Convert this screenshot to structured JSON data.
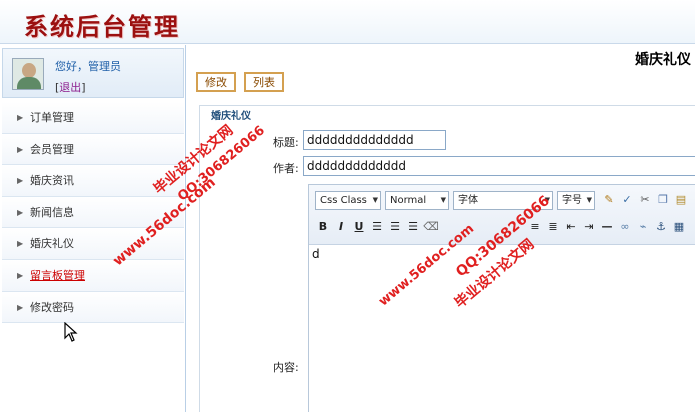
{
  "header": {
    "title": "系统后台管理"
  },
  "user": {
    "greeting": "您好，管理员",
    "logout_open": "[",
    "logout_label": "退出",
    "logout_close": "]"
  },
  "menu": {
    "items": [
      {
        "label": "订单管理"
      },
      {
        "label": "会员管理"
      },
      {
        "label": "婚庆资讯"
      },
      {
        "label": "新闻信息"
      },
      {
        "label": "婚庆礼仪"
      },
      {
        "label": "留言板管理"
      },
      {
        "label": "修改密码"
      }
    ],
    "active_index": 5
  },
  "content": {
    "page_title": "婚庆礼仪",
    "buttons": {
      "edit": "修改",
      "list": "列表"
    },
    "section_legend": "婚庆礼仪",
    "form": {
      "title_label": "标题:",
      "title_value": "dddddddddddddd",
      "author_label": "作者:",
      "author_value": "ddddddddddddd",
      "content_label": "内容:",
      "content_value": "d"
    },
    "editor": {
      "style_select": "Css Class",
      "format_select": "Normal",
      "font_select": "字体",
      "size_select": "字号",
      "icons": [
        "brush-icon",
        "spellcheck-icon",
        "cut-icon",
        "copy-icon",
        "paste-icon",
        "bold-icon",
        "italic-icon",
        "underline-icon",
        "align-left-icon",
        "align-center-icon",
        "align-right-icon",
        "eraser-icon",
        "unordered-list-icon",
        "ordered-list-icon",
        "outdent-icon",
        "indent-icon",
        "horizontal-rule-icon",
        "link-icon",
        "unlink-icon",
        "anchor-icon",
        "table-icon"
      ]
    }
  },
  "watermarks": {
    "cn_left": "毕业设计论文网",
    "qq_left": "QQ:306826066",
    "url_left": "www.56doc.com",
    "url_right": "www.56doc.com",
    "qq_right": "QQ:306826066",
    "cn_right": "毕业设计论文网"
  },
  "colors": {
    "title_red": "#9b1010",
    "link_blue": "#1f5fa8",
    "active_red": "#cc0000",
    "button_border": "#d4a050",
    "watermark": "#e02020"
  }
}
